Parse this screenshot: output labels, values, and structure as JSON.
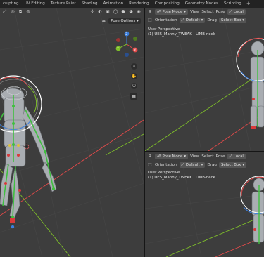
{
  "workspace_tabs": [
    "culpting",
    "UV Editing",
    "Texture Paint",
    "Shading",
    "Animation",
    "Rendering",
    "Compositing",
    "Geometry Nodes",
    "Scripting"
  ],
  "workspace_add": "+",
  "left_view": {
    "pose_options": "Pose Options"
  },
  "right_top": {
    "mode": "Pose Mode",
    "menus": [
      "View",
      "Select",
      "Pose"
    ],
    "transform_space": "Local",
    "orientation_label": "Orientation",
    "orientation_value": "Default",
    "drag_label": "Drag",
    "drag_value": "Select Box",
    "view_name": "User Perspective",
    "object_info": "(1) UE5_Manny_TWEAK : LIMB-neck"
  },
  "right_bottom": {
    "mode": "Pose Mode",
    "menus": [
      "View",
      "Select",
      "Pose"
    ],
    "transform_space": "Local",
    "orientation_label": "Orientation",
    "orientation_value": "Default",
    "drag_label": "Drag",
    "drag_value": "Select Box",
    "view_name": "User Perspective",
    "object_info": "(1) UE5_Manny_TWEAK : LIMB-neck"
  },
  "gizmo_axes": {
    "x": "X",
    "y": "Y",
    "z": "Z"
  },
  "colors": {
    "viewport_bg": "#3d3d3d",
    "x_axis": "#e34a4a",
    "y_axis": "#7fbf2a",
    "z_axis": "#3a7fe0",
    "bone_green": "#3fbf3f",
    "selection_ring": "#ffffff"
  }
}
